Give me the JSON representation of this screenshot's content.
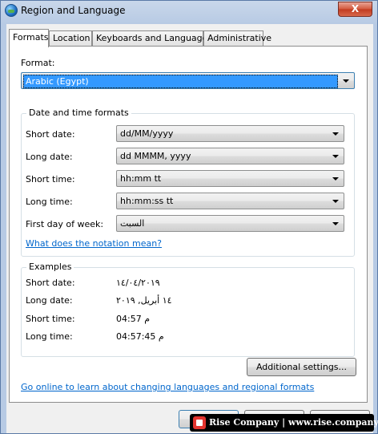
{
  "window": {
    "title": "Region and Language",
    "close_glyph": "X"
  },
  "tabs": [
    {
      "label": "Formats",
      "active": true
    },
    {
      "label": "Location",
      "active": false
    },
    {
      "label": "Keyboards and Languages",
      "active": false
    },
    {
      "label": "Administrative",
      "active": false
    }
  ],
  "format": {
    "label": "Format:",
    "selected": "Arabic (Egypt)"
  },
  "date_time_formats": {
    "title": "Date and time formats",
    "rows": [
      {
        "label": "Short date:",
        "value": "dd/MM/yyyy"
      },
      {
        "label": "Long date:",
        "value": "dd MMMM, yyyy"
      },
      {
        "label": "Short time:",
        "value": "hh:mm tt"
      },
      {
        "label": "Long time:",
        "value": "hh:mm:ss tt"
      },
      {
        "label": "First day of week:",
        "value": "السبت"
      }
    ],
    "notation_link": "What does the notation mean?"
  },
  "examples": {
    "title": "Examples",
    "rows": [
      {
        "label": "Short date:",
        "value": "١٤/٠٤/٢٠١٩"
      },
      {
        "label": "Long date:",
        "value": "١٤ أبريل, ٢٠١٩"
      },
      {
        "label": "Short time:",
        "value": "04:57 م"
      },
      {
        "label": "Long time:",
        "value": "04:57:45 م"
      }
    ]
  },
  "additional_settings_label": "Additional settings...",
  "online_link": "Go online to learn about changing languages and regional formats",
  "watermark": {
    "text": "Rise Company | www.rise.company",
    "bg_color": "#000000",
    "logo_color": "#e3342f"
  },
  "colors": {
    "link": "#0066cc",
    "selection": "#3399ff"
  }
}
